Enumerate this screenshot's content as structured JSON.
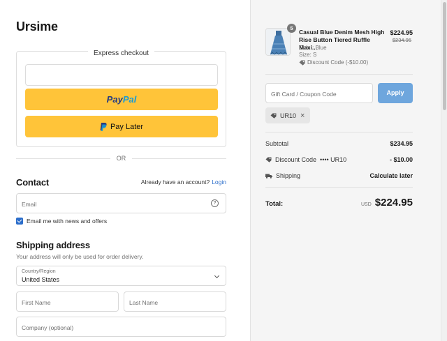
{
  "store": {
    "title": "Ursime"
  },
  "express": {
    "label": "Express checkout",
    "paypal": {
      "part1": "Pay",
      "part2": "Pal"
    },
    "pay_later_label": "Pay Later"
  },
  "divider_or": "OR",
  "contact": {
    "title": "Contact",
    "account_prompt": "Already have an account?",
    "login_link": "Login",
    "email_placeholder": "Email",
    "help_icon": "?",
    "newsletter_label": "Email me with news and offers",
    "newsletter_checked": true
  },
  "shipping": {
    "title": "Shipping address",
    "subtitle": "Your address will only be used for order delivery.",
    "country_label": "Country/Region",
    "country_value": "United States",
    "first_name_placeholder": "First Name",
    "last_name_placeholder": "Last Name",
    "company_placeholder": "Company (optional)"
  },
  "summary": {
    "product": {
      "name": "Casual Blue Denim Mesh High Rise Button Tiered Ruffle Maxi...",
      "quantity": "5",
      "color": "Color: Blue",
      "size": "Size: S",
      "discount": "Discount Code (-$10.00)",
      "price": "$224.95",
      "original_price": "$234.95"
    },
    "coupon_placeholder": "Gift Card / Coupon Code",
    "apply_label": "Apply",
    "applied_code": "UR10",
    "subtotal_label": "Subtotal",
    "subtotal_value": "$234.95",
    "discount_label": "Discount Code",
    "discount_code": "•••• UR10",
    "discount_value": "- $10.00",
    "shipping_label": "Shipping",
    "shipping_value": "Calculate later",
    "total_label": "Total:",
    "currency": "USD",
    "total_value": "$224.95"
  },
  "colors": {
    "paypal_yellow": "#ffc439",
    "link_blue": "#2c6ecb",
    "apply_blue": "#6ea6dd",
    "summary_bg": "#f5f5f5"
  },
  "icons": {
    "help": "help-circle-icon",
    "tag": "tag-icon",
    "truck": "truck-icon",
    "close": "close-icon",
    "chevron": "chevron-down-icon"
  }
}
